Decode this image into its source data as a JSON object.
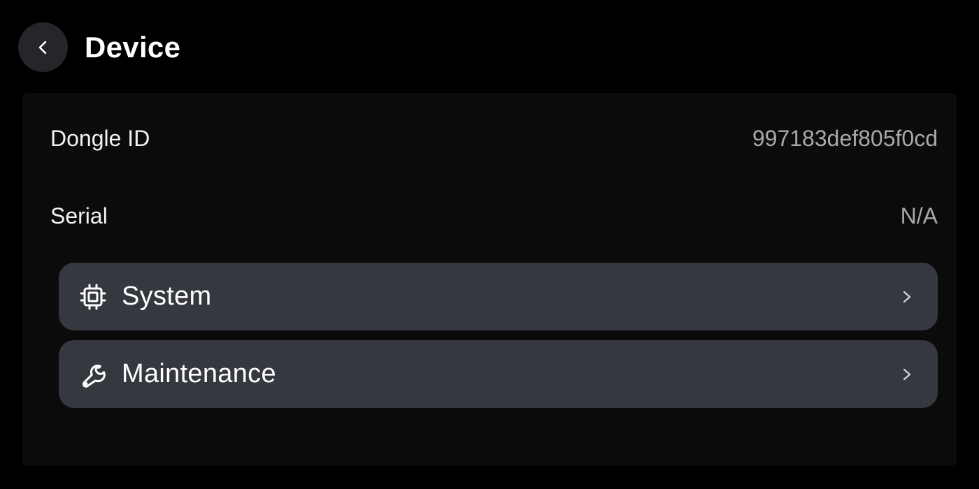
{
  "header": {
    "title": "Device",
    "back_icon": "chevron-left-icon"
  },
  "info": {
    "dongle_id": {
      "label": "Dongle ID",
      "value": "997183def805f0cd"
    },
    "serial": {
      "label": "Serial",
      "value": "N/A"
    }
  },
  "nav": [
    {
      "label": "System",
      "icon": "cpu-chip-icon"
    },
    {
      "label": "Maintenance",
      "icon": "wrench-icon"
    }
  ],
  "colors": {
    "background": "#000000",
    "panel": "#0b0b0c",
    "nav_item": "#36383f",
    "back_button": "#25262a",
    "value_text": "#a9a9ab"
  }
}
